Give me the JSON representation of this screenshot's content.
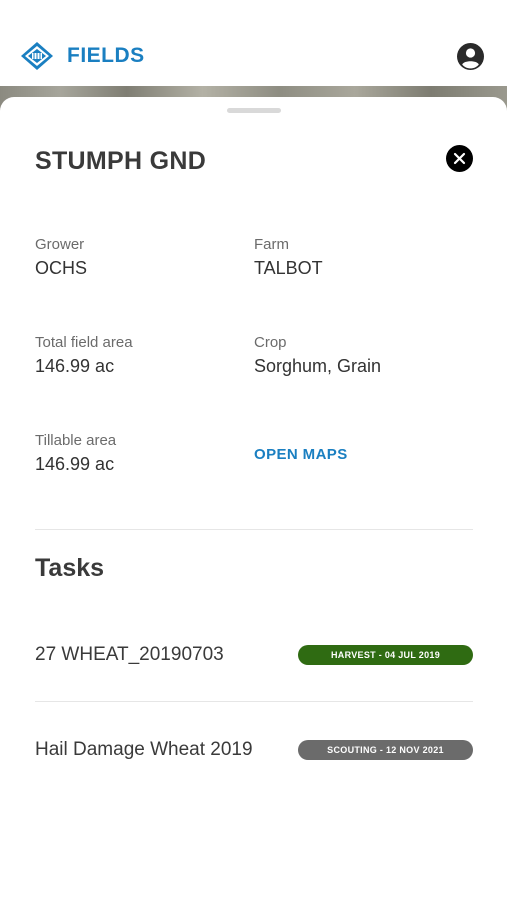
{
  "header": {
    "app_title": "FIELDS",
    "logo_icon": "fields-logo-icon",
    "account_icon": "account-circle-icon"
  },
  "field": {
    "name": "STUMPH GND",
    "close_icon": "close-icon",
    "grower_label": "Grower",
    "grower_value": "OCHS",
    "farm_label": "Farm",
    "farm_value": "TALBOT",
    "total_area_label": "Total field area",
    "total_area_value": "146.99 ac",
    "crop_label": "Crop",
    "crop_value": "Sorghum, Grain",
    "tillable_label": "Tillable area",
    "tillable_value": "146.99 ac",
    "open_maps_label": "OPEN MAPS"
  },
  "tasks": {
    "title": "Tasks",
    "items": [
      {
        "name": "27 WHEAT_20190703",
        "badge": "HARVEST - 04 JUL 2019",
        "badge_color": "#2f6b12"
      },
      {
        "name": "Hail Damage Wheat 2019",
        "badge": "SCOUTING - 12 NOV 2021",
        "badge_color": "#6b6b6b"
      }
    ]
  },
  "colors": {
    "accent": "#1a7fc1",
    "text": "#3a3a3a",
    "harvest": "#2f6b12",
    "scouting": "#6b6b6b"
  }
}
